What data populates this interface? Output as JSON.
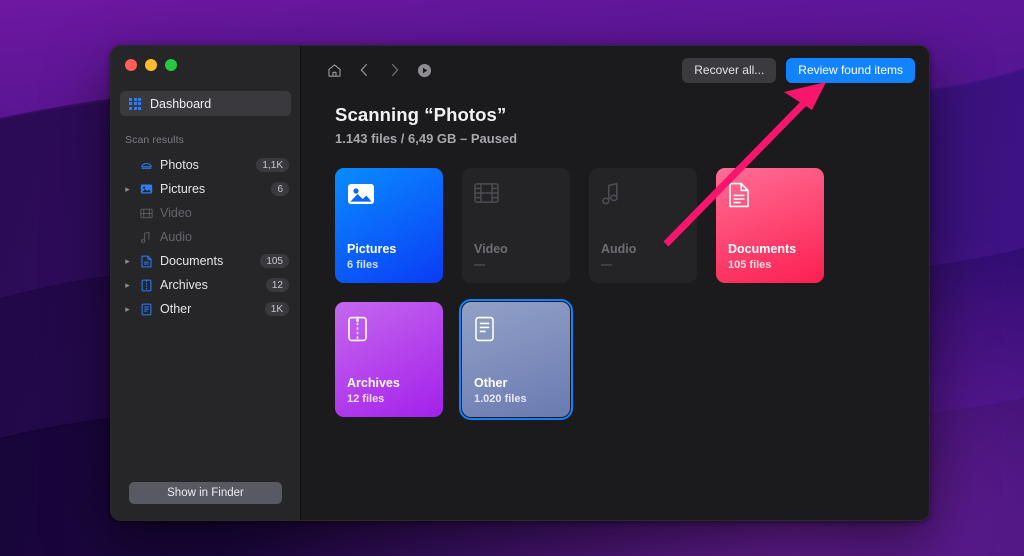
{
  "window": {
    "traffic_lights": [
      "close",
      "minimize",
      "maximize"
    ]
  },
  "sidebar": {
    "dashboard": {
      "label": "Dashboard",
      "icon": "grid-icon"
    },
    "section_title": "Scan results",
    "items": [
      {
        "label": "Photos",
        "badge": "1,1K",
        "icon": "photos-icon",
        "expandable": false,
        "disabled": false
      },
      {
        "label": "Pictures",
        "badge": "6",
        "icon": "pictures-icon",
        "expandable": true,
        "disabled": false
      },
      {
        "label": "Video",
        "badge": "",
        "icon": "video-icon",
        "expandable": false,
        "disabled": true
      },
      {
        "label": "Audio",
        "badge": "",
        "icon": "audio-icon",
        "expandable": false,
        "disabled": true
      },
      {
        "label": "Documents",
        "badge": "105",
        "icon": "documents-icon",
        "expandable": true,
        "disabled": false
      },
      {
        "label": "Archives",
        "badge": "12",
        "icon": "archives-icon",
        "expandable": true,
        "disabled": false
      },
      {
        "label": "Other",
        "badge": "1K",
        "icon": "other-icon",
        "expandable": true,
        "disabled": false
      }
    ],
    "show_in_finder": "Show in Finder"
  },
  "toolbar": {
    "home_icon": "home-icon",
    "back_icon": "chevron-left-icon",
    "forward_icon": "chevron-right-icon",
    "resume_icon": "play-circle-icon",
    "recover_all": "Recover all...",
    "review_found_items": "Review found items",
    "primary_color": "#1283ff"
  },
  "heading": {
    "title": "Scanning “Photos”",
    "subtitle": "1.143 files / 6,49 GB – Paused"
  },
  "tiles": [
    {
      "name": "Pictures",
      "count": "6 files",
      "icon": "image-icon",
      "state": "active",
      "color_start": "#0a84ff",
      "color_end": "#0a3cff"
    },
    {
      "name": "Video",
      "count": "—",
      "icon": "film-icon",
      "state": "empty",
      "color_start": "#242427",
      "color_end": "#242427"
    },
    {
      "name": "Audio",
      "count": "—",
      "icon": "note-icon",
      "state": "empty",
      "color_start": "#242427",
      "color_end": "#242427"
    },
    {
      "name": "Documents",
      "count": "105 files",
      "icon": "document-icon",
      "state": "active",
      "color_start": "#ff6b96",
      "color_end": "#fc2350"
    },
    {
      "name": "Archives",
      "count": "12 files",
      "icon": "zip-icon",
      "state": "active",
      "color_start": "#c264ec",
      "color_end": "#a626ea"
    },
    {
      "name": "Other",
      "count": "1.020 files",
      "icon": "lines-icon",
      "state": "selected",
      "color_start": "#8e9dc4",
      "color_end": "#6c7bb0"
    }
  ],
  "annotation": {
    "arrow_color": "#f8156c",
    "points_to": "review-found-items-button"
  }
}
